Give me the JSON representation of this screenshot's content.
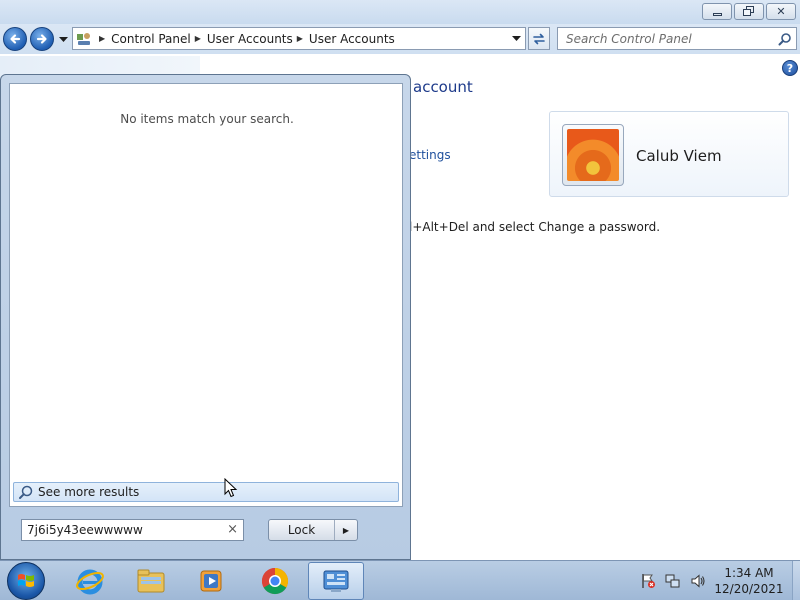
{
  "window": {
    "caption_buttons": {
      "minimize": "minimize-icon",
      "maximize": "restore-icon",
      "close_glyph": "✕"
    }
  },
  "navigation": {
    "breadcrumb": [
      "Control Panel",
      "User Accounts",
      "User Accounts"
    ],
    "search_placeholder": "Search Control Panel"
  },
  "content": {
    "title_partial": "account",
    "link_partial": "ettings",
    "instruction_partial": "l+Alt+Del and select Change a password.",
    "user_name": "Calub Viem"
  },
  "help_glyph": "?",
  "start_menu": {
    "no_items_text": "No items match your search.",
    "see_more_label": "See more results",
    "search_value": "7j6i5y43eewwwww",
    "clear_glyph": "×",
    "lock_label": "Lock",
    "lock_arrow_glyph": "▶"
  },
  "taskbar": {
    "pinned": [
      "start-orb-icon",
      "internet-explorer-icon",
      "windows-explorer-icon",
      "media-player-icon",
      "chrome-icon",
      "control-panel-icon"
    ],
    "active_item": "control-panel-icon",
    "clock_time": "1:34 AM",
    "clock_date": "12/20/2021"
  },
  "colors": {
    "link_blue": "#1e4f9c",
    "title_blue": "#1d3a8a",
    "taskbar": "#9fb8d6"
  }
}
